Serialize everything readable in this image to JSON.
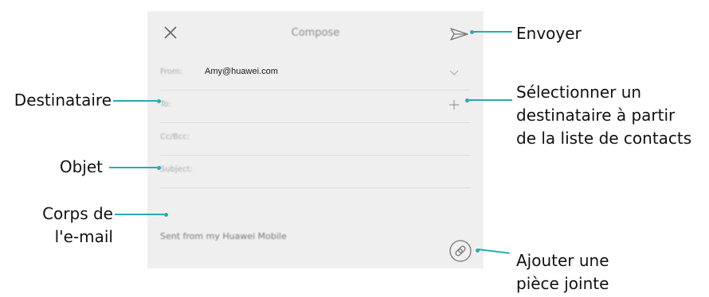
{
  "screen": {
    "title": "Compose",
    "from_label": "From:",
    "from_value": "Amy@huawei.com",
    "to_label": "To:",
    "cc_label": "Cc/Bcc:",
    "subject_label": "Subject:",
    "body_text": "Sent from my Huawei Mobile",
    "icons": {
      "close": "close-icon",
      "send": "send-icon",
      "expand": "chevron-down-icon",
      "add": "plus-icon",
      "attach": "paperclip-icon"
    }
  },
  "callouts": {
    "send": "Envoyer",
    "recipient": "Destinataire",
    "select_contact": [
      "Sélectionner un",
      "destinataire à partir",
      "de la liste de contacts"
    ],
    "subject": "Objet",
    "body": [
      "Corps de",
      "l'e-mail"
    ],
    "attachment": [
      "Ajouter une",
      "pièce jointe"
    ]
  },
  "colors": {
    "leader": "#2aa9b5",
    "screen_bg": "#efefef"
  }
}
